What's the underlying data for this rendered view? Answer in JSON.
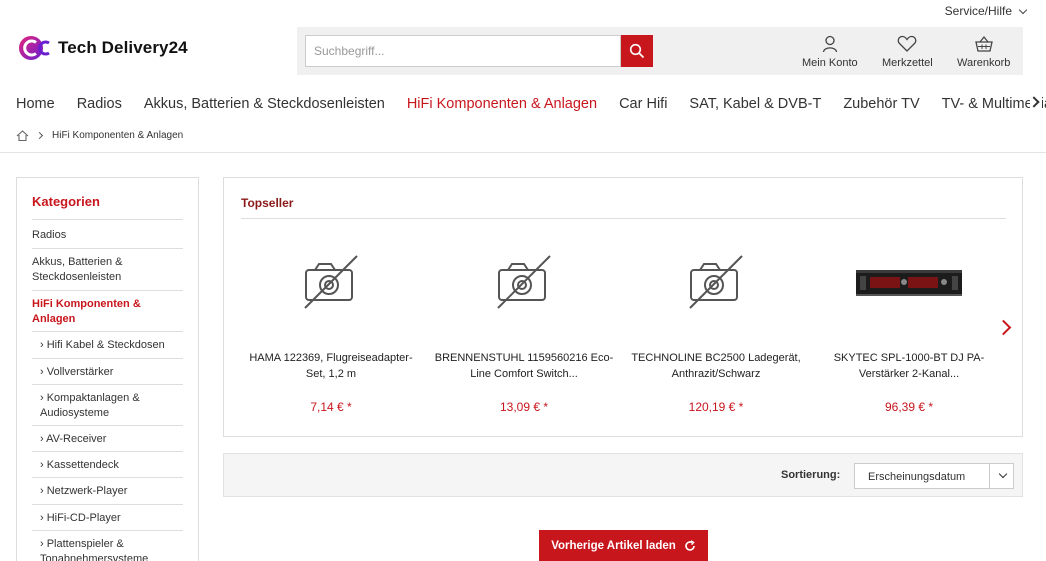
{
  "header": {
    "service_label": "Service/Hilfe",
    "logo_text": "Tech Delivery24",
    "search_placeholder": "Suchbegriff...",
    "account_label": "Mein Konto",
    "wishlist_label": "Merkzettel",
    "cart_label": "Warenkorb"
  },
  "nav": {
    "items": [
      "Home",
      "Radios",
      "Akkus, Batterien & Steckdosenleisten",
      "HiFi Komponenten & Anlagen",
      "Car Hifi",
      "SAT, Kabel & DVB-T",
      "Zubehör TV",
      "TV- & Multimedia"
    ],
    "active_index": 3
  },
  "breadcrumb": {
    "current": "HiFi Komponenten & Anlagen"
  },
  "sidebar": {
    "title": "Kategorien",
    "items": [
      "Radios",
      "Akkus, Batterien & Steckdosenleisten",
      "HiFi Komponenten & Anlagen"
    ],
    "subitems": [
      "› Hifi Kabel & Steckdosen",
      "› Vollverstärker",
      "› Kompaktanlagen & Audiosysteme",
      "› AV-Receiver",
      "› Kassettendeck",
      "› Netzwerk-Player",
      "› HiFi-CD-Player",
      "› Plattenspieler & Tonabnehmersysteme"
    ]
  },
  "topseller": {
    "title": "Topseller",
    "products": [
      {
        "name": "HAMA 122369, Flugreiseadapter-Set, 1,2 m",
        "price": "7,14 € *",
        "image": "no-image-icon"
      },
      {
        "name": "BRENNENSTUHL 1159560216 Eco-Line Comfort Switch...",
        "price": "13,09 € *",
        "image": "no-image-icon"
      },
      {
        "name": "TECHNOLINE BC2500 Ladegerät, Anthrazit/Schwarz",
        "price": "120,19 € *",
        "image": "no-image-icon"
      },
      {
        "name": "SKYTEC SPL-1000-BT DJ PA-Verstärker 2-Kanal...",
        "price": "96,39 € *",
        "image": "amplifier-product-image"
      }
    ]
  },
  "sorting": {
    "label": "Sortierung:",
    "selected": "Erscheinungsdatum"
  },
  "load_prev_label": "Vorherige Artikel laden",
  "colors": {
    "accent": "#c8161d",
    "topseller_title": "#8b1a1a"
  }
}
